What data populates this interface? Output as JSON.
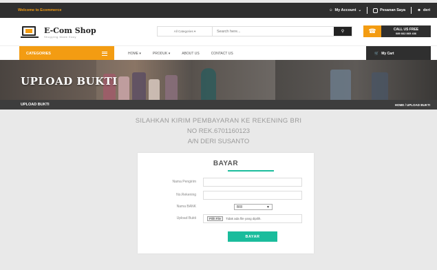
{
  "topbar": {
    "welcome": "Welcome to Ecommerce",
    "my_account": "My Account",
    "pesanan": "Pesanan Saya",
    "user": "deri"
  },
  "header": {
    "logo_title": "E-Com Shop",
    "logo_subtitle": "Shopping Made Easy",
    "search_category": "All Categories",
    "search_placeholder": "Search here...",
    "call_line1": "CALL US FREE",
    "call_line2": "089 662 865 436"
  },
  "nav": {
    "categories": "CATEGORIES",
    "links": [
      "HOME",
      "PRODUK",
      "ABOUT US",
      "CONTACT US"
    ],
    "cart": "My Cart"
  },
  "banner": {
    "title": "UPLOAD BUKTI"
  },
  "crumb": {
    "page": "UPLOAD BUKTI",
    "path": "HOME / UPLOAD BUKTI"
  },
  "notice": {
    "line1": "SILAHKAN KIRIM PEMBAYARAN KE REKENING BRI",
    "line2": "NO REK.6701160123",
    "line3": "A/N DERI SUSANTO"
  },
  "form": {
    "title": "BAYAR",
    "fields": [
      {
        "label": "Nama Pengirim",
        "value": ""
      },
      {
        "label": "No.Rekening",
        "value": ""
      }
    ],
    "bank_label": "Nama BANK",
    "bank_value": "BRI",
    "upload_label": "Upload Bukti",
    "file_button": "Pilih File",
    "file_status": "Tidak ada file yang dipilih.",
    "submit": "BAYAR"
  },
  "colors": {
    "accent": "#f39c12",
    "dark": "#2f2f2f",
    "teal": "#1abc9c"
  }
}
